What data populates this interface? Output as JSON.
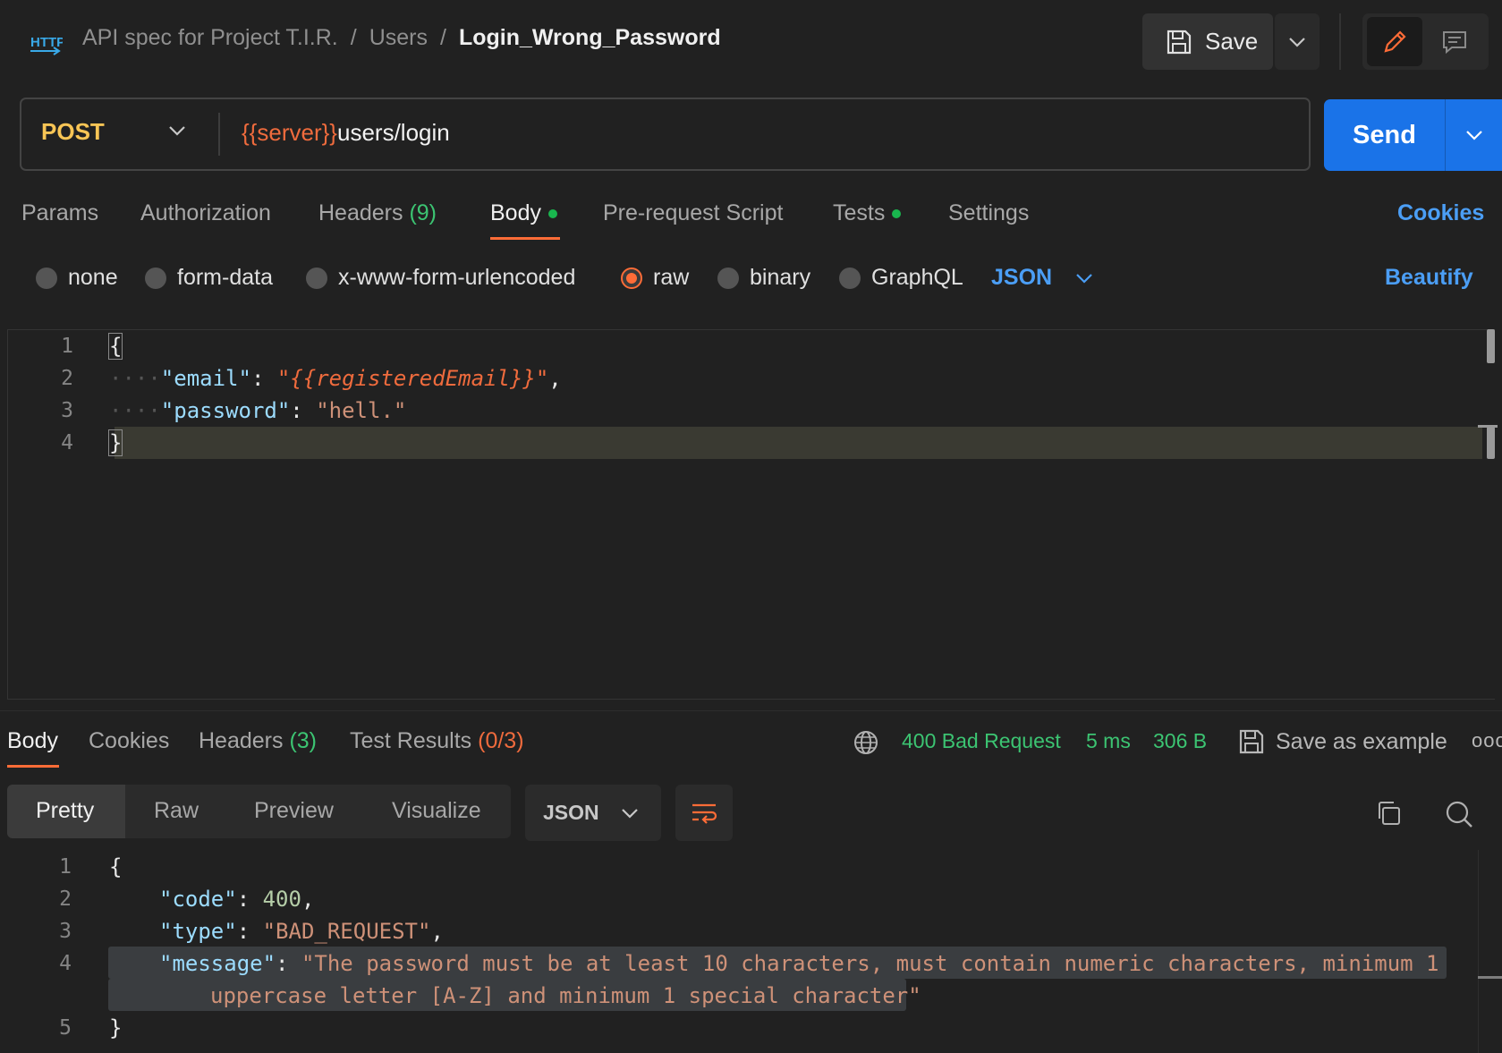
{
  "header": {
    "icon_label": "HTTP",
    "breadcrumb": [
      "API spec for Project T.I.R.",
      "Users",
      "Login_Wrong_Password"
    ],
    "separator": "/",
    "save_label": "Save"
  },
  "request": {
    "method": "POST",
    "url_variable": "{{server}}",
    "url_path": "users/login",
    "send_label": "Send"
  },
  "request_tabs": {
    "params": "Params",
    "authorization": "Authorization",
    "headers": "Headers",
    "headers_count": "(9)",
    "body": "Body",
    "pre_request": "Pre-request Script",
    "tests": "Tests",
    "settings": "Settings",
    "cookies": "Cookies"
  },
  "body_options": {
    "none": "none",
    "form_data": "form-data",
    "urlencoded": "x-www-form-urlencoded",
    "raw": "raw",
    "binary": "binary",
    "graphql": "GraphQL",
    "language": "JSON",
    "beautify": "Beautify"
  },
  "request_body": {
    "line_numbers": [
      "1",
      "2",
      "3",
      "4"
    ],
    "open_brace": "{",
    "close_brace": "}",
    "indent": "····",
    "email_key": "\"email\"",
    "email_value": "\"{{registeredEmail}}\"",
    "password_key": "\"password\"",
    "password_value": "\"hell.\""
  },
  "response_tabs": {
    "body": "Body",
    "cookies": "Cookies",
    "headers": "Headers",
    "headers_count": "(3)",
    "test_results": "Test Results",
    "test_results_count": "(0/3)"
  },
  "response_meta": {
    "status": "400 Bad Request",
    "time": "5 ms",
    "size": "306 B",
    "save_example": "Save as example",
    "more": "ooo"
  },
  "view_modes": {
    "pretty": "Pretty",
    "raw": "Raw",
    "preview": "Preview",
    "visualize": "Visualize",
    "format": "JSON"
  },
  "response_body": {
    "line_numbers": [
      "1",
      "2",
      "3",
      "4",
      "",
      "5"
    ],
    "open_brace": "{",
    "close_brace": "}",
    "code_key": "\"code\"",
    "code_value": "400",
    "type_key": "\"type\"",
    "type_value": "\"BAD_REQUEST\"",
    "message_key": "\"message\"",
    "message_line1": "\"The password must be at least 10 characters, must contain numeric characters, minimum 1",
    "message_line2": "uppercase letter [A-Z] and minimum 1 special character\""
  },
  "colors": {
    "accent": "#ff6c37",
    "primary": "#1a73e8",
    "method": "#f8c555",
    "success": "#3cc472"
  }
}
